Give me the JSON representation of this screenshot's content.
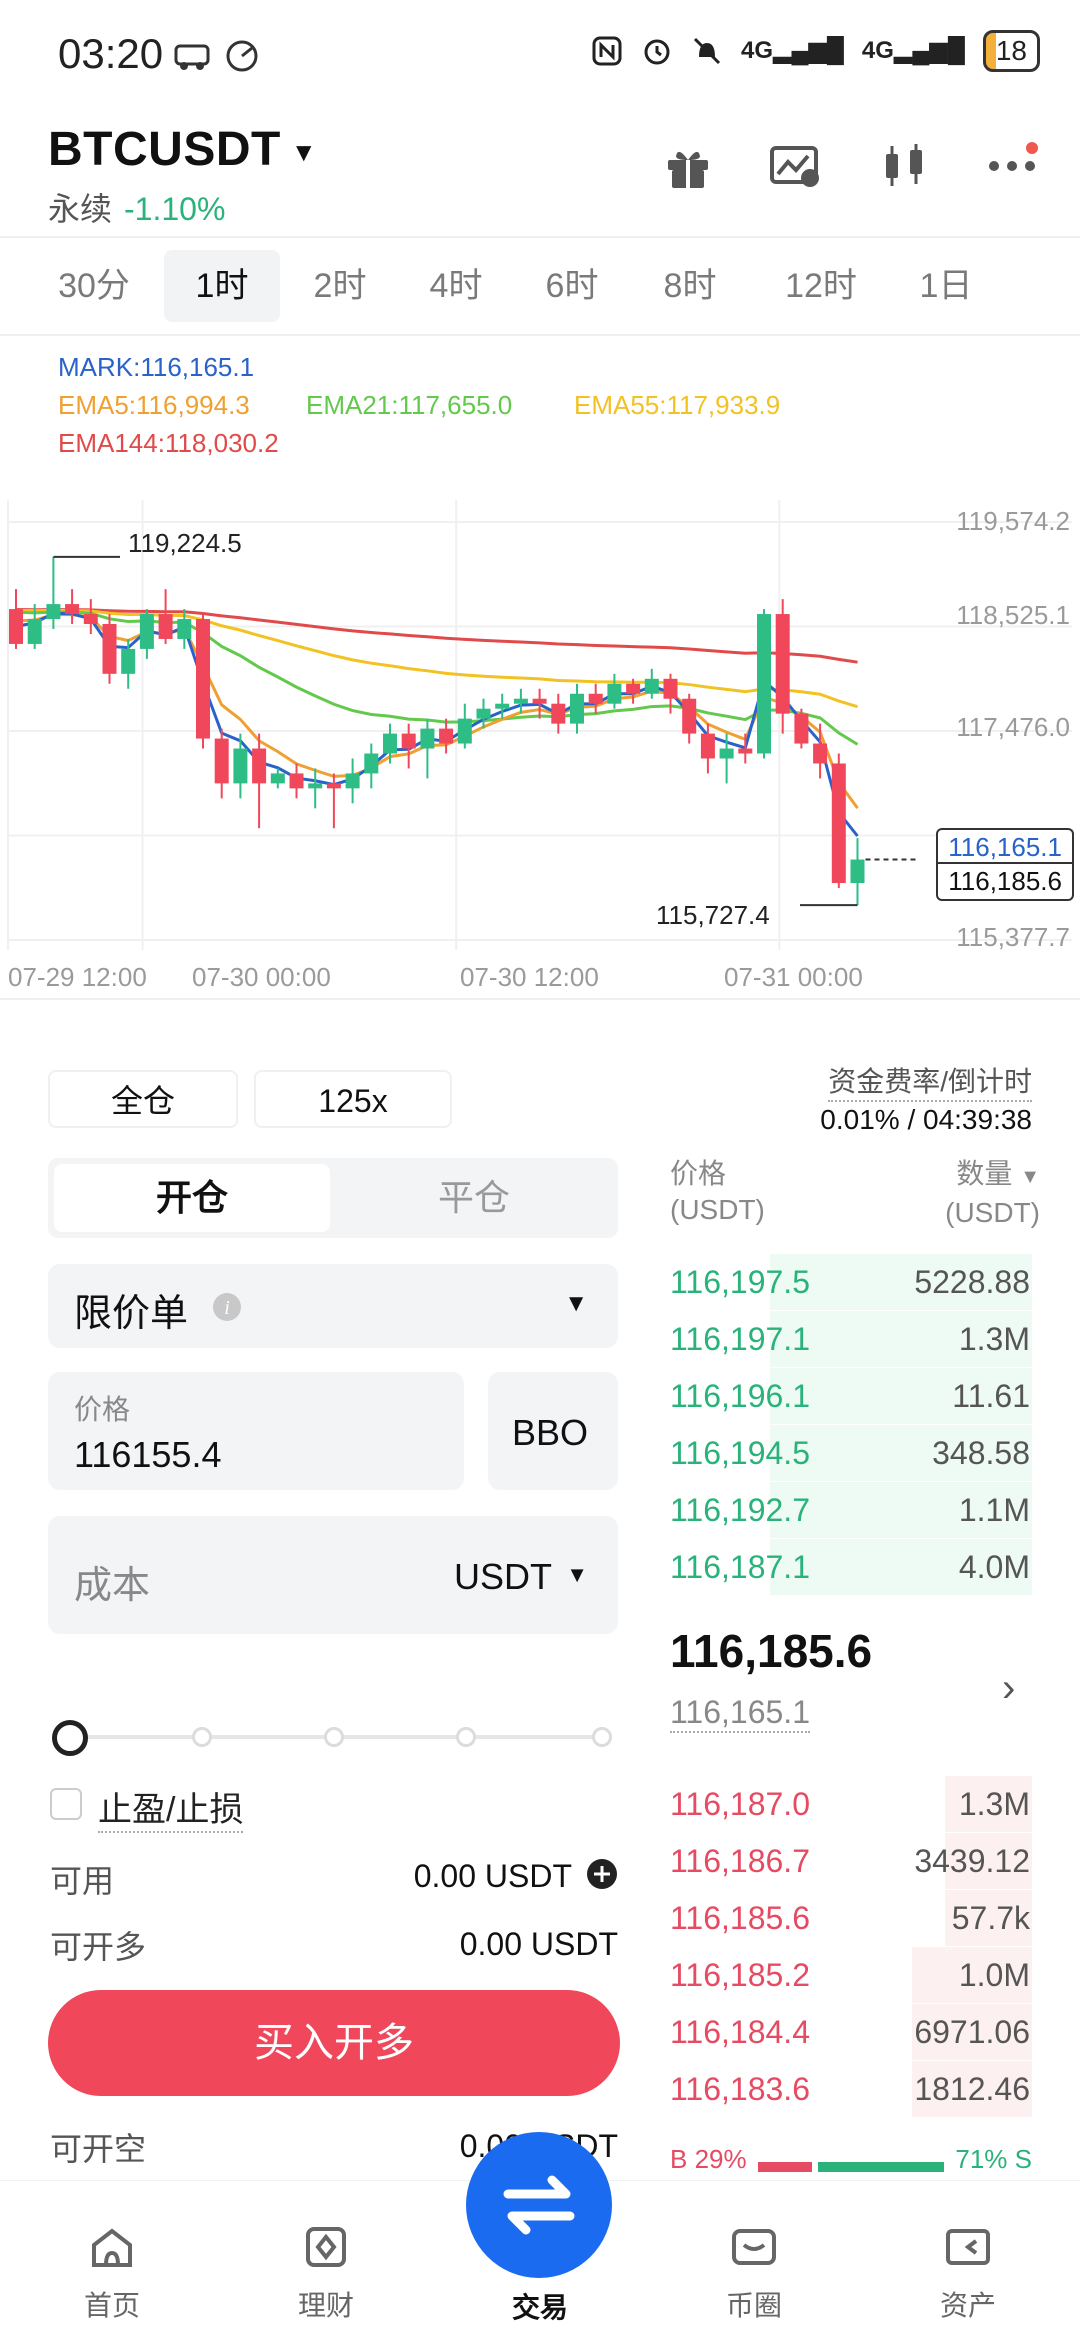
{
  "status_bar": {
    "time": "03:20",
    "signal1": "4G",
    "signal2": "4G",
    "battery": "18"
  },
  "header": {
    "symbol": "BTCUSDT",
    "type": "永续",
    "change": "-1.10%"
  },
  "intervals": [
    "30分",
    "1时",
    "2时",
    "4时",
    "6时",
    "8时",
    "12时",
    "1日"
  ],
  "active_interval": "1时",
  "chart_data": {
    "type": "candlestick",
    "legend": {
      "mark": "MARK:116,165.1",
      "ema5": "EMA5:116,994.3",
      "ema21": "EMA21:117,655.0",
      "ema55": "EMA55:117,933.9",
      "ema144": "EMA144:118,030.2"
    },
    "colors": {
      "up": "#2ebd85",
      "down": "#f0475b",
      "mark": "#2962c9",
      "ema5": "#f0a030",
      "ema21": "#63c94c",
      "ema55": "#f2c222",
      "ema144": "#e04a4a"
    },
    "y_ticks": [
      "119,574.2",
      "118,525.1",
      "117,476.0",
      "115,377.7"
    ],
    "x_ticks": [
      "07-29 12:00",
      "07-30 00:00",
      "07-30 12:00",
      "07-31 00:00"
    ],
    "ylim": [
      115377.7,
      119574.2
    ],
    "high_label": "119,224.5",
    "low_label": "115,727.4",
    "last_mark": "116,165.1",
    "last_price": "116,185.6",
    "candles": [
      [
        118700,
        118350,
        118900,
        118300
      ],
      [
        118350,
        118600,
        118750,
        118300
      ],
      [
        118600,
        118750,
        119224.5,
        118500
      ],
      [
        118750,
        118650,
        118900,
        118550
      ],
      [
        118650,
        118550,
        118800,
        118450
      ],
      [
        118550,
        118050,
        118650,
        117950
      ],
      [
        118050,
        118300,
        118400,
        117900
      ],
      [
        118300,
        118650,
        118700,
        118200
      ],
      [
        118650,
        118400,
        118900,
        118350
      ],
      [
        118400,
        118600,
        118700,
        118300
      ],
      [
        118600,
        117400,
        118650,
        117300
      ],
      [
        117400,
        116950,
        117500,
        116800
      ],
      [
        116950,
        117300,
        117450,
        116800
      ],
      [
        117300,
        116950,
        117450,
        116500
      ],
      [
        116950,
        117050,
        117100,
        116900
      ],
      [
        117050,
        116900,
        117150,
        116800
      ],
      [
        116900,
        116950,
        117100,
        116700
      ],
      [
        116950,
        116900,
        117050,
        116500
      ],
      [
        116900,
        117050,
        117200,
        116750
      ],
      [
        117050,
        117250,
        117350,
        116900
      ],
      [
        117250,
        117450,
        117550,
        117150
      ],
      [
        117450,
        117300,
        117550,
        117100
      ],
      [
        117300,
        117500,
        117600,
        117000
      ],
      [
        117500,
        117350,
        117600,
        117250
      ],
      [
        117350,
        117600,
        117750,
        117300
      ],
      [
        117600,
        117700,
        117800,
        117500
      ],
      [
        117700,
        117750,
        117850,
        117600
      ],
      [
        117750,
        117800,
        117900,
        117650
      ],
      [
        117800,
        117750,
        117900,
        117600
      ],
      [
        117750,
        117550,
        117850,
        117450
      ],
      [
        117550,
        117850,
        117950,
        117450
      ],
      [
        117850,
        117750,
        117950,
        117650
      ],
      [
        117750,
        117950,
        118050,
        117700
      ],
      [
        117950,
        117850,
        118000,
        117750
      ],
      [
        117850,
        118000,
        118100,
        117800
      ],
      [
        118000,
        117800,
        118050,
        117650
      ],
      [
        117800,
        117450,
        117850,
        117350
      ],
      [
        117450,
        117200,
        117550,
        117050
      ],
      [
        117200,
        117300,
        117450,
        116950
      ],
      [
        117300,
        117250,
        117450,
        117150
      ],
      [
        117250,
        118650,
        118700,
        117200
      ],
      [
        118650,
        117650,
        118800,
        117450
      ],
      [
        117650,
        117350,
        117700,
        117300
      ],
      [
        117350,
        117150,
        117550,
        117000
      ],
      [
        117150,
        115950,
        117250,
        115900
      ],
      [
        115950,
        116185.6,
        116400,
        115727.4
      ]
    ]
  },
  "order_form": {
    "margin_mode": "全仓",
    "leverage": "125x",
    "tab_open": "开仓",
    "tab_close": "平仓",
    "order_type": "限价单",
    "price_label": "价格",
    "price_value": "116155.4",
    "bbo": "BBO",
    "cost_placeholder": "成本",
    "cost_unit": "USDT",
    "tp_sl": "止盈/止损",
    "available_label": "可用",
    "available_value": "0.00 USDT",
    "max_long_label": "可开多",
    "max_long_value": "0.00 USDT",
    "buy_button": "买入开多",
    "max_short_label": "可开空",
    "max_short_value": "0.00 USDT"
  },
  "funding": {
    "label": "资金费率/倒计时",
    "value": "0.01% / 04:39:38"
  },
  "orderbook": {
    "price_header": "价格",
    "price_unit": "(USDT)",
    "qty_header": "数量",
    "qty_unit": "(USDT)",
    "bids": [
      {
        "price": "116,197.5",
        "qty": "5228.88",
        "depth": 0.72
      },
      {
        "price": "116,197.1",
        "qty": "1.3M",
        "depth": 0.72
      },
      {
        "price": "116,196.1",
        "qty": "11.61",
        "depth": 0.72
      },
      {
        "price": "116,194.5",
        "qty": "348.58",
        "depth": 0.72
      },
      {
        "price": "116,192.7",
        "qty": "1.1M",
        "depth": 0.72
      },
      {
        "price": "116,187.1",
        "qty": "4.0M",
        "depth": 0.72
      }
    ],
    "mid_price": "116,185.6",
    "mark_price": "116,165.1",
    "asks": [
      {
        "price": "116,187.0",
        "qty": "1.3M",
        "depth": 0.24
      },
      {
        "price": "116,186.7",
        "qty": "3439.12",
        "depth": 0.24
      },
      {
        "price": "116,185.6",
        "qty": "57.7k",
        "depth": 0.24
      },
      {
        "price": "116,185.2",
        "qty": "1.0M",
        "depth": 0.33
      },
      {
        "price": "116,184.4",
        "qty": "6971.06",
        "depth": 0.33
      },
      {
        "price": "116,183.6",
        "qty": "1812.46",
        "depth": 0.33
      }
    ],
    "ratio_buy": "B 29%",
    "ratio_sell": "71% S",
    "ratio_buy_fraction": 0.29
  },
  "bottom_nav": [
    {
      "label": "首页",
      "icon": "home-icon"
    },
    {
      "label": "理财",
      "icon": "wealth-icon"
    },
    {
      "label": "交易",
      "icon": "trade-swap-icon"
    },
    {
      "label": "币圈",
      "icon": "community-icon"
    },
    {
      "label": "资产",
      "icon": "assets-icon"
    }
  ]
}
